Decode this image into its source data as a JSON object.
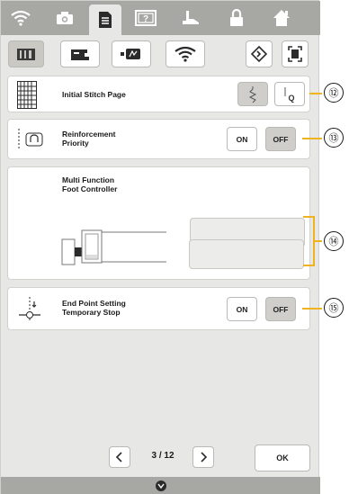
{
  "top_tabs": [
    "wifi-icon",
    "camera-icon",
    "document-icon",
    "help-icon",
    "sewing-foot-icon",
    "lock-icon",
    "home-icon"
  ],
  "sub_tabs": [
    "machine-icon",
    "sewing-machine-icon",
    "embroidery-icon",
    "wifi-icon",
    "diamond-icon",
    "fullscreen-icon"
  ],
  "settings": {
    "stitch_page": {
      "label": "Initial Stitch Page",
      "options": [
        "zigzag-stitch-icon",
        "q-stitch-icon"
      ],
      "selected": 0
    },
    "reinforcement": {
      "label_line1": "Reinforcement",
      "label_line2": "Priority",
      "on": "ON",
      "off": "OFF",
      "selected": "OFF"
    },
    "foot_controller": {
      "label_line1": "Multi Function",
      "label_line2": "Foot Controller",
      "field1": "",
      "field2": ""
    },
    "end_point": {
      "label_line1": "End Point Setting",
      "label_line2": "Temporary Stop",
      "on": "ON",
      "off": "OFF",
      "selected": "OFF"
    }
  },
  "pagination": {
    "text": "3 / 12",
    "prev": "chevron-left-icon",
    "next": "chevron-right-icon"
  },
  "ok_label": "OK",
  "callouts": [
    "⑫",
    "⑬",
    "⑭",
    "⑮"
  ],
  "colors": {
    "bar": "#a7a8a3",
    "accent": "#f0b21e"
  }
}
